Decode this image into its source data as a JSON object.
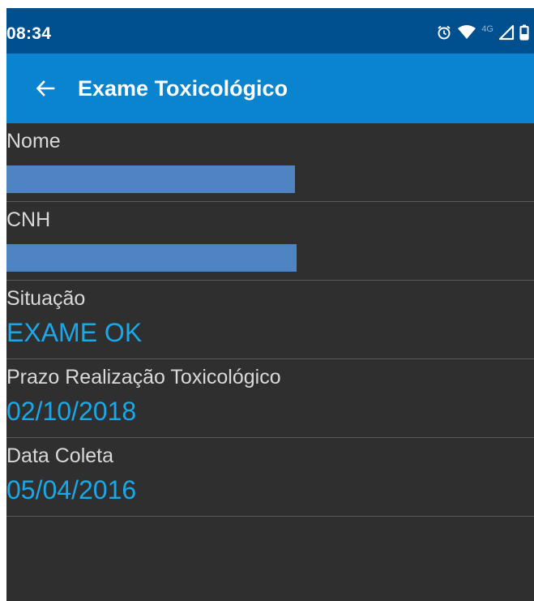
{
  "status_bar": {
    "time": "08:34",
    "network": "4G",
    "icons": [
      "alarm-icon",
      "wifi-icon",
      "signal-icon",
      "battery-icon"
    ]
  },
  "toolbar": {
    "back_icon": "arrow-left-icon",
    "title": "Exame Toxicológico"
  },
  "fields": [
    {
      "label": "Nome",
      "value": "",
      "redacted": true
    },
    {
      "label": "CNH",
      "value": "",
      "redacted": true
    },
    {
      "label": "Situação",
      "value": "EXAME OK"
    },
    {
      "label": "Prazo Realização Toxicológico",
      "value": "02/10/2018"
    },
    {
      "label": "Data Coleta",
      "value": "05/04/2016"
    }
  ],
  "colors": {
    "status_bar": "#00508f",
    "toolbar": "#0a84cf",
    "background": "#2f2f2f",
    "value_text": "#1aa8e8",
    "label_text": "#d9d9d9",
    "redaction": "#4f84c2"
  }
}
